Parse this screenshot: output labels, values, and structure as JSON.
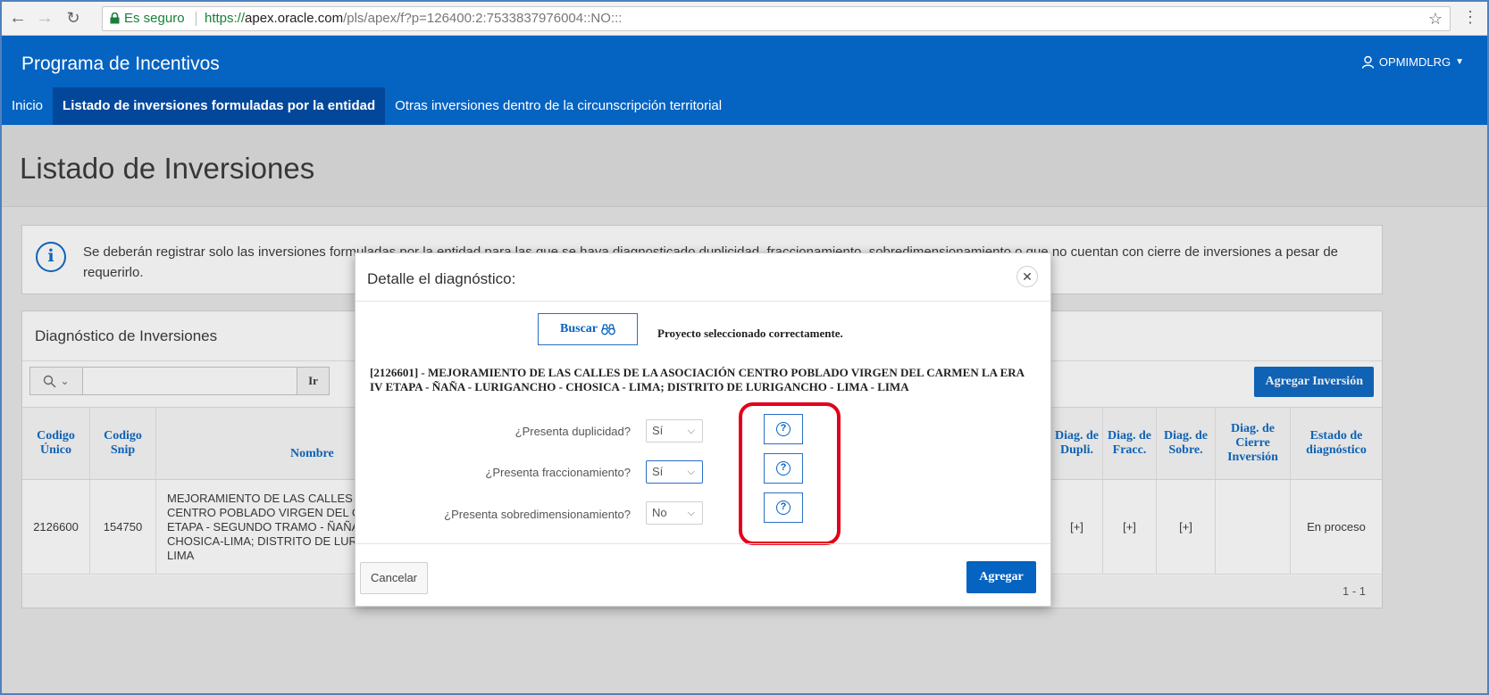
{
  "browser": {
    "secure_label": "Es seguro",
    "url_scheme": "https://",
    "url_host": "apex.oracle.com",
    "url_path": "/pls/apex/f?p=126400:2:7533837976004::NO:::"
  },
  "header": {
    "app_title": "Programa de Incentivos",
    "user": "OPMIMDLRG"
  },
  "nav": {
    "tabs": [
      {
        "label": "Inicio"
      },
      {
        "label": "Listado de inversiones formuladas por la entidad"
      },
      {
        "label": "Otras inversiones dentro de la circunscripción territorial"
      }
    ]
  },
  "page": {
    "title": "Listado de Inversiones",
    "alert": "Se deberán registrar solo las inversiones formuladas por la entidad para las que se haya diagnosticado duplicidad, fraccionamiento, sobredimensionamiento o que no cuentan con cierre de inversiones a pesar de requerirlo."
  },
  "region": {
    "title": "Diagnóstico de Inversiones",
    "go_label": "Ir",
    "add_label": "Agregar Inversión",
    "columns": {
      "codigo_unico": "Codigo Único",
      "codigo_snip": "Codigo Snip",
      "nombre": "Nombre",
      "diag_dupli": "Diag. de Dupli.",
      "diag_fracc": "Diag. de Fracc.",
      "diag_sobre": "Diag. de Sobre.",
      "diag_cierre": "Diag. de Cierre Inversión",
      "estado": "Estado de diagnóstico"
    },
    "row": {
      "codigo_unico": "2126600",
      "codigo_snip": "154750",
      "nombre_lines": [
        "MEJORAMIENTO DE LAS CALLES DE",
        "CENTRO POBLADO VIRGEN DEL CAR",
        "ETAPA - SEGUNDO TRAMO - ÑAÑA",
        "CHOSICA-LIMA; DISTRITO DE LURIGA",
        "LIMA"
      ],
      "diag_dupli": "[+]",
      "diag_fracc": "[+]",
      "diag_sobre": "[+]",
      "estado": "En proceso"
    },
    "pager": "1 - 1"
  },
  "modal": {
    "title": "Detalle el diagnóstico:",
    "search_label": "Buscar",
    "status_msg": "Proyecto seleccionado correctamente.",
    "project": "[2126601] - MEJORAMIENTO DE LAS CALLES DE LA ASOCIACIÓN CENTRO POBLADO VIRGEN DEL CARMEN LA ERA IV ETAPA - ÑAÑA - LURIGANCHO - CHOSICA - LIMA; DISTRITO DE LURIGANCHO - LIMA - LIMA",
    "questions": [
      {
        "label": "¿Presenta duplicidad?",
        "value": "Sí"
      },
      {
        "label": "¿Presenta fraccionamiento?",
        "value": "Sí"
      },
      {
        "label": "¿Presenta sobredimensionamiento?",
        "value": "No"
      }
    ],
    "cancel_label": "Cancelar",
    "add_label": "Agregar"
  },
  "colors": {
    "brand_blue": "#0563c1",
    "highlight_red": "#e2001a"
  }
}
